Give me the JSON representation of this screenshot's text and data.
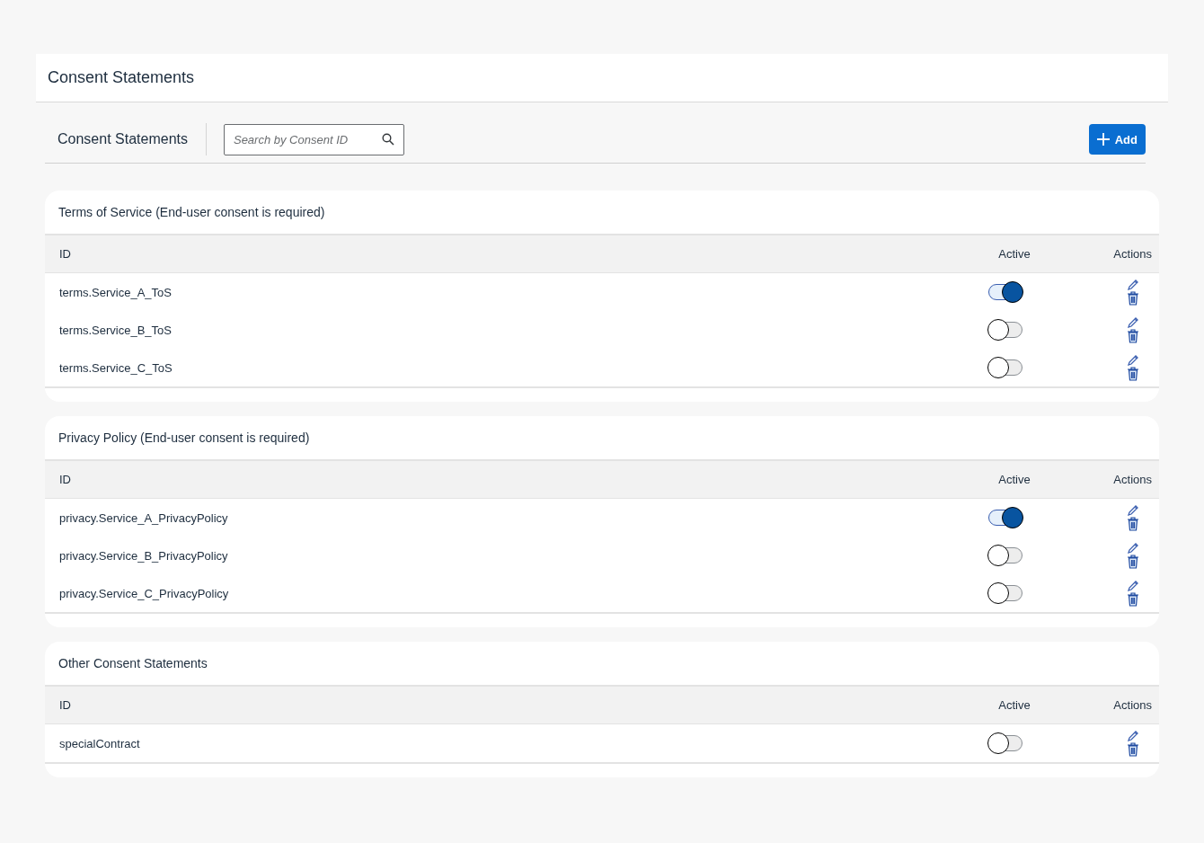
{
  "page_title": "Consent Statements",
  "toolbar": {
    "title": "Consent Statements",
    "search": {
      "placeholder": "Search by Consent ID"
    },
    "add_button": "Add"
  },
  "sections": [
    {
      "title": "Terms of Service (End-user consent is required)",
      "columns": [
        "ID",
        "Active",
        "Actions"
      ],
      "rows": [
        {
          "id": "terms.Service_A_ToS",
          "active": true
        },
        {
          "id": "terms.Service_B_ToS",
          "active": false
        },
        {
          "id": "terms.Service_C_ToS",
          "active": false
        }
      ]
    },
    {
      "title": "Privacy Policy (End-user consent is required)",
      "columns": [
        "ID",
        "Active",
        "Actions"
      ],
      "rows": [
        {
          "id": "privacy.Service_A_PrivacyPolicy",
          "active": true
        },
        {
          "id": "privacy.Service_B_PrivacyPolicy",
          "active": false
        },
        {
          "id": "privacy.Service_C_PrivacyPolicy",
          "active": false
        }
      ]
    },
    {
      "title": "Other Consent Statements",
      "columns": [
        "ID",
        "Active",
        "Actions"
      ],
      "rows": [
        {
          "id": "specialContract",
          "active": false
        }
      ]
    }
  ]
}
